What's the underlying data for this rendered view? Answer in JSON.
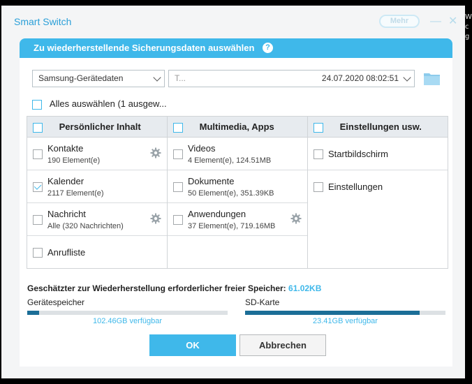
{
  "app": {
    "title": "Smart Switch",
    "more_label": "Mehr"
  },
  "dialog": {
    "title": "Zu wiederherstellende Sicherungsdaten auswählen"
  },
  "device_select": {
    "value": "Samsung-Gerätedaten"
  },
  "backup_select": {
    "value_name": "T...",
    "value_date": "24.07.2020 08:02:51"
  },
  "select_all": {
    "label": "Alles auswählen (1 ausgew...",
    "checked": false
  },
  "columns": [
    {
      "header": "Persönlicher Inhalt",
      "rows": [
        {
          "label": "Kontakte",
          "sub": "190 Element(e)",
          "checked": false,
          "gear": true
        },
        {
          "label": "Kalender",
          "sub": "2117 Element(e)",
          "checked": true,
          "gear": false
        },
        {
          "label": "Nachricht",
          "sub": "Alle (320 Nachrichten)",
          "checked": false,
          "gear": true
        },
        {
          "label": "Anrufliste",
          "sub": "",
          "checked": false,
          "gear": false
        }
      ]
    },
    {
      "header": "Multimedia, Apps",
      "rows": [
        {
          "label": "Videos",
          "sub": "4 Element(e), 124.51MB",
          "checked": false,
          "gear": false
        },
        {
          "label": "Dokumente",
          "sub": "50 Element(e), 351.39KB",
          "checked": false,
          "gear": false
        },
        {
          "label": "Anwendungen",
          "sub": "37 Element(e), 719.16MB",
          "checked": false,
          "gear": true
        }
      ]
    },
    {
      "header": "Einstellungen usw.",
      "rows": [
        {
          "label": "Startbildschirm",
          "sub": "",
          "checked": false,
          "gear": false
        },
        {
          "label": "Einstellungen",
          "sub": "",
          "checked": false,
          "gear": false
        }
      ]
    }
  ],
  "storage": {
    "label": "Geschätzter zur Wiederherstellung erforderlicher freier Speicher:",
    "value": "61.02KB",
    "device": {
      "label": "Gerätespeicher",
      "available": "102.46GB verfügbar",
      "used_fraction": 0.06
    },
    "sd": {
      "label": "SD-Karte",
      "available": "23.41GB verfügbar",
      "used_fraction": 0.87
    }
  },
  "buttons": {
    "ok": "OK",
    "cancel": "Abbrechen"
  },
  "colors": {
    "accent": "#3fb8ea",
    "bar_fill": "#1b6e97",
    "header_bg": "#e7ebef"
  },
  "side_text": {
    "chars": [
      "W",
      "c",
      "g"
    ]
  }
}
